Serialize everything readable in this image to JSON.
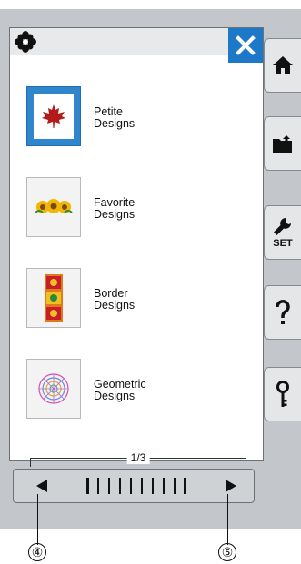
{
  "menu": {
    "items": [
      {
        "label": "Petite\nDesigns",
        "icon": "maple-leaf-icon",
        "selected": true
      },
      {
        "label": "Favorite\nDesigns",
        "icon": "sunflower-design-icon",
        "selected": false
      },
      {
        "label": "Border\nDesigns",
        "icon": "border-design-icon",
        "selected": false
      },
      {
        "label": "Geometric\nDesigns",
        "icon": "geometric-design-icon",
        "selected": false
      }
    ],
    "page_indicator": "1/3"
  },
  "sidebar": {
    "set_label": "SET"
  },
  "callouts": [
    "④",
    "⑤"
  ],
  "colors": {
    "accent": "#1d78c8",
    "device_bg": "#c3c7cc"
  }
}
